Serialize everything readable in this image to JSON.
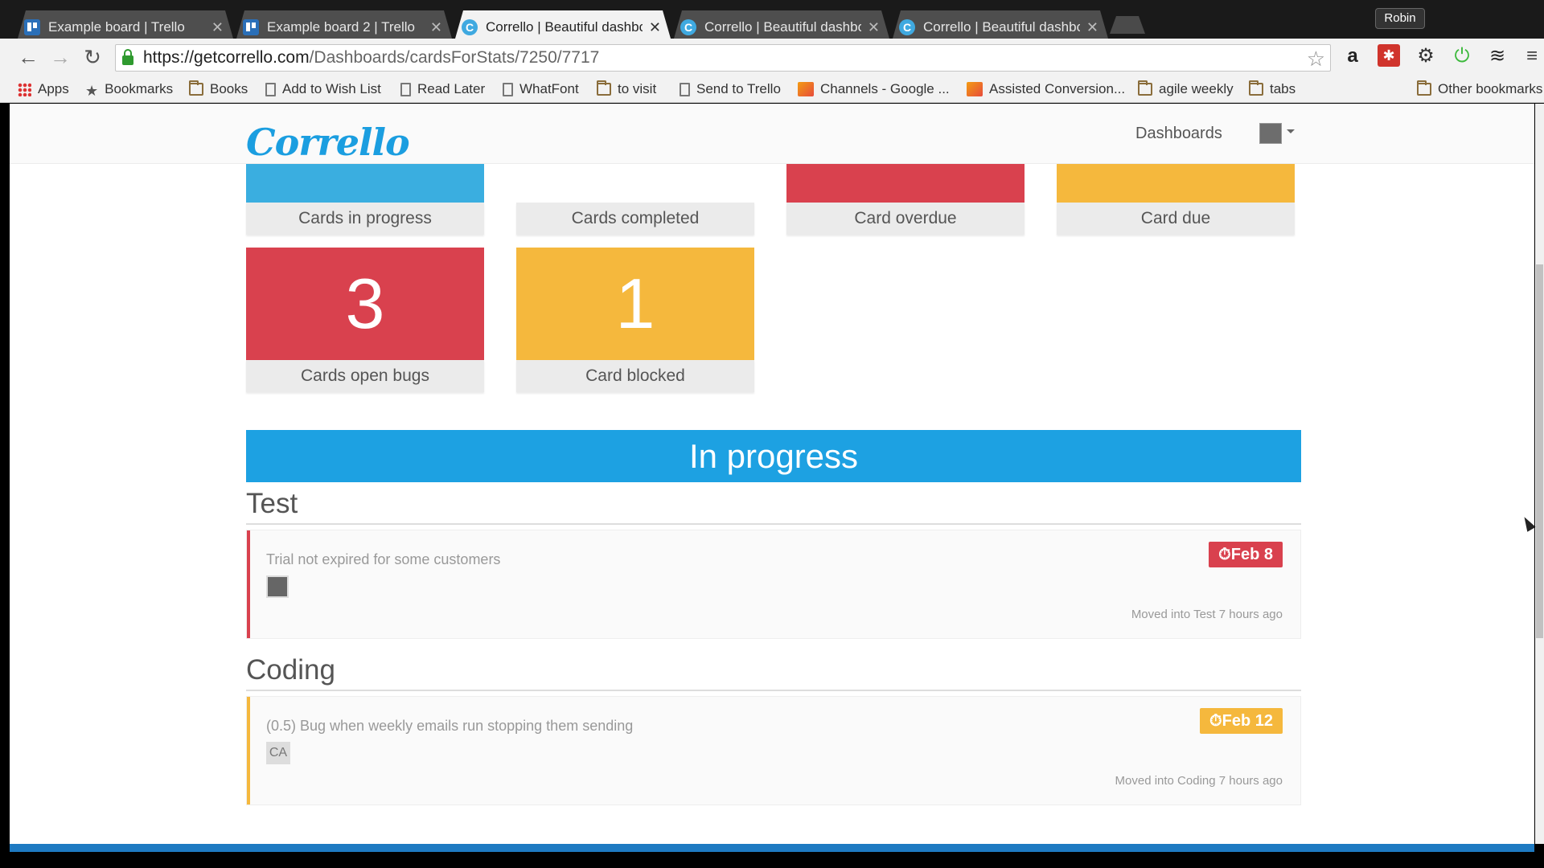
{
  "browser": {
    "tabs": [
      {
        "title": "Example board | Trello",
        "favicon": "trello-icon",
        "active": false
      },
      {
        "title": "Example board 2 | Trello",
        "favicon": "trello-icon",
        "active": false
      },
      {
        "title": "Corrello | Beautiful dashbc",
        "favicon": "corrello-icon",
        "active": true
      },
      {
        "title": "Corrello | Beautiful dashbc",
        "favicon": "corrello-icon",
        "active": false
      },
      {
        "title": "Corrello | Beautiful dashbc",
        "favicon": "corrello-icon",
        "active": false
      }
    ],
    "profile_name": "Robin",
    "url_host": "https://getcorrello.com",
    "url_path": "/Dashboards/cardsForStats/7250/7717",
    "bookmarks": [
      {
        "label": "Apps",
        "icon": "apps-icon"
      },
      {
        "label": "Bookmarks",
        "icon": "star-icon"
      },
      {
        "label": "Books",
        "icon": "folder-icon"
      },
      {
        "label": "Add to Wish List",
        "icon": "page-icon"
      },
      {
        "label": "Read Later",
        "icon": "page-icon"
      },
      {
        "label": "WhatFont",
        "icon": "page-icon"
      },
      {
        "label": "to visit",
        "icon": "folder-icon"
      },
      {
        "label": "Send to Trello",
        "icon": "page-icon"
      },
      {
        "label": "Channels - Google ...",
        "icon": "chart-icon"
      },
      {
        "label": "Assisted Conversion...",
        "icon": "chart-icon"
      },
      {
        "label": "agile weekly",
        "icon": "folder-icon"
      },
      {
        "label": "tabs",
        "icon": "folder-icon"
      },
      {
        "label": "Other bookmarks",
        "icon": "folder-icon"
      }
    ]
  },
  "site": {
    "logo": "Corrello",
    "nav_dashboards": "Dashboards"
  },
  "tiles": [
    {
      "label": "Cards in progress",
      "value": "",
      "color": "#3aaee0"
    },
    {
      "label": "Cards completed",
      "value": "",
      "color": "#ffffff"
    },
    {
      "label": "Card overdue",
      "value": "",
      "color": "#d9414e"
    },
    {
      "label": "Card due",
      "value": "",
      "color": "#f5b83d"
    },
    {
      "label": "Cards open bugs",
      "value": "3",
      "color": "#d9414e"
    },
    {
      "label": "Card blocked",
      "value": "1",
      "color": "#f5b83d"
    }
  ],
  "section_title": "In progress",
  "lists": [
    {
      "name": "Test",
      "card": {
        "title": "Trial not expired for some customers",
        "due": "Feb 8",
        "due_color": "#d9414e",
        "bar_color": "#d9414e",
        "member": "avatar",
        "moved": "Moved into Test 7 hours ago"
      }
    },
    {
      "name": "Coding",
      "card": {
        "title": "(0.5) Bug when weekly emails run stopping them sending",
        "due": "Feb 12",
        "due_color": "#f5b83d",
        "bar_color": "#f5b83d",
        "member": "CA",
        "moved": "Moved into Coding 7 hours ago"
      }
    }
  ]
}
